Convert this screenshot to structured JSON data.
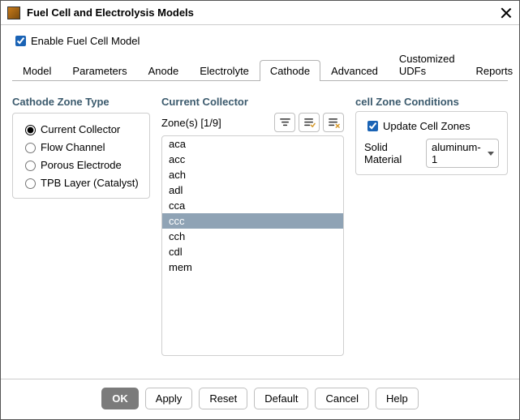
{
  "window": {
    "title": "Fuel Cell and Electrolysis Models"
  },
  "enable": {
    "label": "Enable Fuel Cell Model",
    "checked": true
  },
  "tabs": [
    {
      "label": "Model",
      "active": false
    },
    {
      "label": "Parameters",
      "active": false
    },
    {
      "label": "Anode",
      "active": false
    },
    {
      "label": "Electrolyte",
      "active": false
    },
    {
      "label": "Cathode",
      "active": true
    },
    {
      "label": "Advanced",
      "active": false
    },
    {
      "label": "Customized UDFs",
      "active": false
    },
    {
      "label": "Reports",
      "active": false
    }
  ],
  "cathode_zone_type": {
    "title": "Cathode Zone Type",
    "options": [
      {
        "label": "Current Collector",
        "selected": true
      },
      {
        "label": "Flow Channel",
        "selected": false
      },
      {
        "label": "Porous Electrode",
        "selected": false
      },
      {
        "label": "TPB Layer (Catalyst)",
        "selected": false
      }
    ]
  },
  "collector": {
    "title": "Current Collector",
    "zones_label": "Zone(s) [1/9]",
    "items": [
      {
        "name": "aca",
        "selected": false
      },
      {
        "name": "acc",
        "selected": false
      },
      {
        "name": "ach",
        "selected": false
      },
      {
        "name": "adl",
        "selected": false
      },
      {
        "name": "cca",
        "selected": false
      },
      {
        "name": "ccc",
        "selected": true
      },
      {
        "name": "cch",
        "selected": false
      },
      {
        "name": "cdl",
        "selected": false
      },
      {
        "name": "mem",
        "selected": false
      }
    ]
  },
  "czc": {
    "title": "cell Zone Conditions",
    "update_label": "Update Cell Zones",
    "update_checked": true,
    "solid_label": "Solid Material",
    "solid_value": "aluminum-1"
  },
  "buttons": {
    "ok": "OK",
    "apply": "Apply",
    "reset": "Reset",
    "default": "Default",
    "cancel": "Cancel",
    "help": "Help"
  }
}
